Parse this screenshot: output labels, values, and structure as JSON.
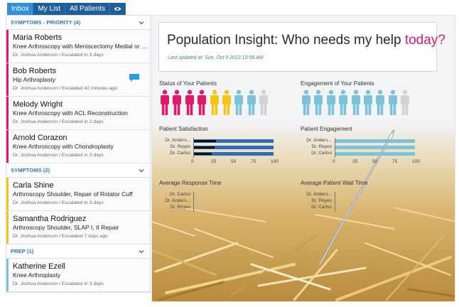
{
  "tabs": [
    {
      "label": "Inbox",
      "active": true
    },
    {
      "label": "My List",
      "active": false
    },
    {
      "label": "All Patients",
      "active": false
    }
  ],
  "eye_icon": "eye-icon",
  "sidebar": {
    "groups": [
      {
        "title": "SYMPTOMS - PRIORITY (4)",
        "color": "#e0196d",
        "patients": [
          {
            "name": "Maria Roberts",
            "procedure": "Knee Arthroscopy with Meniscectomy Medial or Lateral",
            "meta": "Dr. Joshua Anderson / Escalated in 3 days"
          },
          {
            "name": "Bob Roberts",
            "procedure": "Hip Arthroplasty",
            "meta": "Dr. Joshua Anderson / Escalated 42 minutes ago",
            "icon": "chat-bubble-icon"
          },
          {
            "name": "Melody Wright",
            "procedure": "Knee Arthroscopy with ACL Reconstruction",
            "meta": "Dr. Joshua Anderson / Escalated in 2 days"
          },
          {
            "name": "Arnold Corazon",
            "procedure": "Knee Arthroscopy with Chondroplasty",
            "meta": "Dr. Joshua Anderson / Escalated in 3 days"
          }
        ]
      },
      {
        "title": "SYMPTOMS (2)",
        "color": "#f5c518",
        "patients": [
          {
            "name": "Carla Shine",
            "procedure": "Arthroscopy Shoulder, Repair of Rotator Cuff",
            "meta": "Dr. Joshua Anderson / Escalated in 3 days"
          },
          {
            "name": "Samantha Rodriguez",
            "procedure": "Arthroscopy Shoulder, SLAP I, II Repair",
            "meta": "Dr. Joshua Anderson / Escalated 7 days ago"
          }
        ]
      },
      {
        "title": "PREP (1)",
        "color": "#7cc3d9",
        "patients": [
          {
            "name": "Katherine Ezell",
            "procedure": "Knee Arthroplasty",
            "meta": "Dr. Joshua Anderson / Escalated in 3 days"
          }
        ]
      }
    ]
  },
  "hero": {
    "title_prefix": "Population Insight: Who needs my help ",
    "title_accent": "today?",
    "updated": "Last updated at: Sun, Oct 6 2013 10:58 AM"
  },
  "status": {
    "title": "Status of Your Patients",
    "people_colors": [
      "#e0196d",
      "#e0196d",
      "#e0196d",
      "#e0196d",
      "#f5c518",
      "#f5c518",
      "#7cc3d9",
      "#7cc3d9",
      "#d2d2d2"
    ]
  },
  "engagement_people": {
    "title": "Engagement of Your Patients",
    "people_colors": [
      "#7cc3d9",
      "#7cc3d9",
      "#7cc3d9",
      "#7cc3d9",
      "#7cc3d9",
      "#7cc3d9",
      "#7cc3d9",
      "#7cc3d9",
      "#d2d2d2"
    ]
  },
  "chart_data": [
    {
      "type": "bar",
      "title": "Patient Satisfaction",
      "categories": [
        "Dr. Anders...",
        "Dr. Reyes",
        "Dr. Carlso"
      ],
      "xticks": [
        "0",
        "25",
        "50",
        "75",
        "100"
      ],
      "xlim": [
        0,
        100
      ],
      "series": [
        {
          "values": [
            100,
            100,
            100
          ],
          "color": "#2d6db5"
        },
        {
          "values": [
            28,
            26,
            22
          ],
          "color": "#111111"
        }
      ]
    },
    {
      "type": "bar",
      "title": "Patient Engagement",
      "categories": [
        "Dr. Anders...",
        "Dr. Reyes",
        "Dr. Carlso"
      ],
      "xticks": [
        "0",
        "25",
        "50",
        "75",
        "100"
      ],
      "xlim": [
        0,
        100
      ],
      "series": [
        {
          "values": [
            100,
            100,
            100
          ],
          "color": "#7cc3d9"
        }
      ]
    },
    {
      "type": "bar",
      "title": "Average Response Time",
      "categories": [
        "Dr. Carlso",
        "Dr. Anders...",
        "Dr. Reyes"
      ],
      "series": []
    },
    {
      "type": "bar",
      "title": "Average Patient Wait Time",
      "categories": [
        "Dr. Anders...",
        "Dr. Reyes",
        "Dr. Carlso"
      ],
      "series": []
    }
  ]
}
